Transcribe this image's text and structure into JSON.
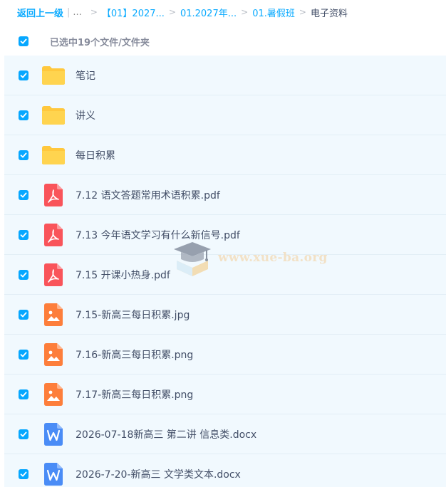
{
  "breadcrumb": {
    "back": "返回上一级",
    "separator": "|",
    "ellipsis": "...",
    "crumbs": [
      "【01】2027...",
      "01.2027年...",
      "01.暑假班"
    ],
    "current": "电子资料"
  },
  "selection": {
    "label": "已选中19个文件/文件夹"
  },
  "files": [
    {
      "name": "笔记",
      "type": "folder-icon"
    },
    {
      "name": "讲义",
      "type": "folder-icon"
    },
    {
      "name": "每日积累",
      "type": "folder-icon"
    },
    {
      "name": "7.12 语文答题常用术语积累.pdf",
      "type": "pdf-icon"
    },
    {
      "name": "7.13 今年语文学习有什么新信号.pdf",
      "type": "pdf-icon"
    },
    {
      "name": "7.15 开课小热身.pdf",
      "type": "pdf-icon"
    },
    {
      "name": "7.15-新高三每日积累.jpg",
      "type": "image-icon"
    },
    {
      "name": "7.16-新高三每日积累.png",
      "type": "image-icon"
    },
    {
      "name": "7.17-新高三每日积累.png",
      "type": "image-icon"
    },
    {
      "name": "2026-07-18新高三 第二讲 信息类.docx",
      "type": "word-icon"
    },
    {
      "name": "2026-7-20-新高三 文学类文本.docx",
      "type": "word-icon"
    }
  ],
  "watermark": {
    "text": "www.xue-ba.org"
  },
  "colors": {
    "accent": "#06a7ff",
    "folder": "#ffd44f",
    "pdf": "#f9545a",
    "image": "#fd7e3b",
    "word": "#4a8cf6",
    "row_bg": "#f1f9fe"
  }
}
